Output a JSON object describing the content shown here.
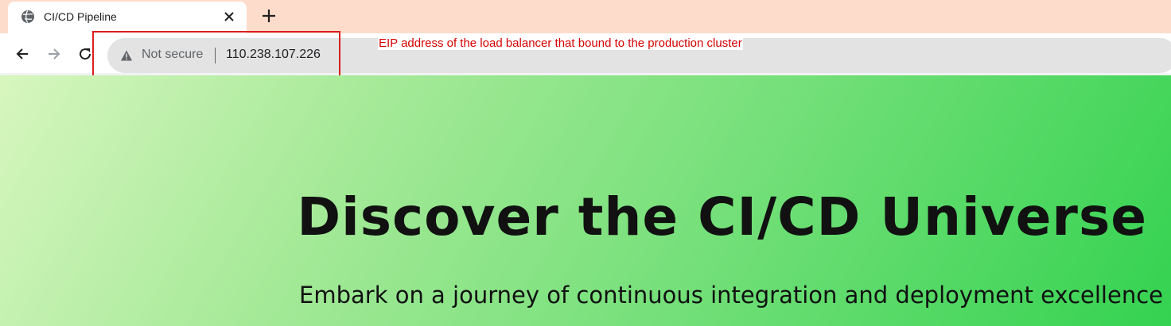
{
  "tab": {
    "title": "CI/CD Pipeline",
    "favicon_icon": "globe-icon",
    "close_icon": "close-icon"
  },
  "toolbar": {
    "new_tab_icon": "plus-icon",
    "back_icon": "arrow-left-icon",
    "forward_icon": "arrow-right-icon",
    "reload_icon": "reload-icon"
  },
  "omnibox": {
    "security_icon": "warning-triangle-icon",
    "security_label": "Not secure",
    "url": "110.238.107.226"
  },
  "annotation": {
    "text": "EIP address of the load balancer that bound to the production cluster",
    "color": "#d60000"
  },
  "page": {
    "title": "Discover the CI/CD Universe",
    "subtitle": "Embark on a journey of continuous integration and deployment excellence",
    "gradient_start": "#d7f6bf",
    "gradient_end": "#34d251"
  },
  "colors": {
    "tabstrip": "#fddccb",
    "omnibox": "#e3e3e3",
    "annotation_border": "#d9201f"
  }
}
